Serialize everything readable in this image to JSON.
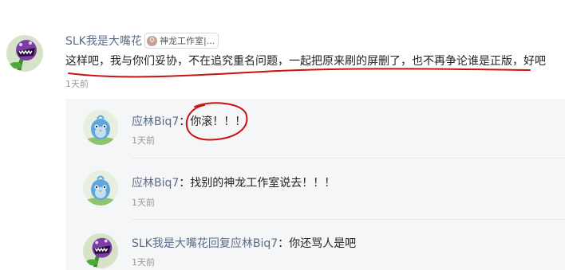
{
  "comment": {
    "user_name": "SLK我是大嘴花",
    "badge_level": "0",
    "badge_text": "神龙工作室|...",
    "text": "这样吧，我与你们妥协，不在追究重名问题，一起把原来刷的屏删了，也不再争论谁是正版，好吧",
    "time": "1天前",
    "avatar_icon": "piranha-plant-avatar-icon"
  },
  "replies": [
    {
      "user_name": "应林Biq7",
      "separator": "：",
      "text": "你滚！！！",
      "time": "1天前",
      "avatar_icon": "blue-bird-avatar-icon"
    },
    {
      "user_name": "应林Biq7",
      "separator": "：",
      "text": "找别的神龙工作室说去！！！",
      "time": "1天前",
      "avatar_icon": "blue-bird-avatar-icon"
    },
    {
      "user_name": "SLK我是大嘴花回复应林Biq7",
      "separator": "：",
      "text": "你还骂人是吧",
      "time": "1天前",
      "avatar_icon": "piranha-plant-avatar-icon"
    }
  ],
  "colors": {
    "username": "#5b6b86",
    "reply_panel_bg": "#f5f6f7",
    "annotation_ink": "#cc1111"
  }
}
